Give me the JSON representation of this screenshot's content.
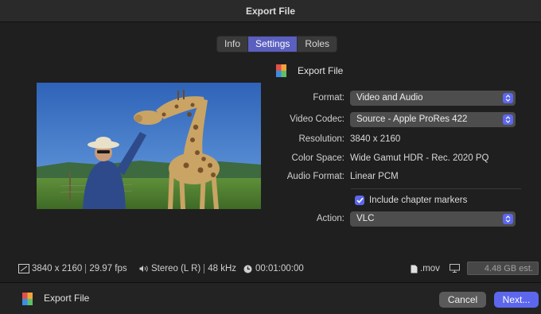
{
  "window": {
    "title": "Export File"
  },
  "tabs": [
    {
      "label": "Info",
      "active": false
    },
    {
      "label": "Settings",
      "active": true
    },
    {
      "label": "Roles",
      "active": false
    }
  ],
  "header": {
    "label": "Export File"
  },
  "settings": {
    "format": {
      "label": "Format:",
      "value": "Video and Audio"
    },
    "video_codec": {
      "label": "Video Codec:",
      "value": "Source - Apple ProRes 422"
    },
    "resolution": {
      "label": "Resolution:",
      "value": "3840 x 2160"
    },
    "color_space": {
      "label": "Color Space:",
      "value": "Wide Gamut HDR - Rec. 2020 PQ"
    },
    "audio_format": {
      "label": "Audio Format:",
      "value": "Linear PCM"
    },
    "chapter_markers": {
      "label": "Include chapter markers",
      "checked": true
    },
    "action": {
      "label": "Action:",
      "value": "VLC"
    }
  },
  "status": {
    "resolution": "3840 x 2160",
    "fps": "29.97 fps",
    "audio": "Stereo (L R)",
    "sample_rate": "48 kHz",
    "duration": "00:01:00:00",
    "container": ".mov",
    "size_estimate": "4.48 GB est."
  },
  "footer": {
    "label": "Export File",
    "cancel": "Cancel",
    "next": "Next..."
  },
  "colors": {
    "accent": "#5c67ee",
    "tab_active": "#5b5fbf",
    "background": "#1f1f1f"
  },
  "icons": {
    "app": "final-cut-icon",
    "screen": "screen-size-icon",
    "speaker": "speaker-icon",
    "clock": "clock-icon",
    "file": "document-icon",
    "display": "display-icon",
    "chevron": "updown-chevron-icon",
    "check": "checkmark-icon"
  }
}
